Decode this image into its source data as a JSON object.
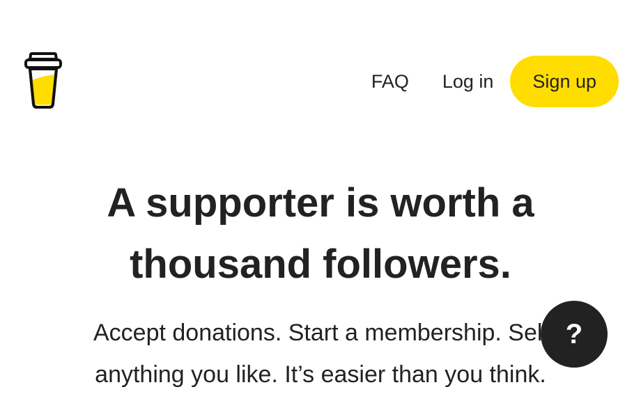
{
  "header": {
    "logo_name": "buy-me-a-coffee-cup-icon",
    "nav": {
      "faq_label": "FAQ",
      "login_label": "Log in",
      "signup_label": "Sign up"
    }
  },
  "hero": {
    "title_line1": "A supporter is worth a",
    "title_line2": "thousand followers.",
    "subtitle_line1": "Accept donations. Start a membership. Sell",
    "subtitle_line2": "anything you like. It’s easier than you think."
  },
  "help_widget": {
    "icon": "question-mark-icon",
    "label": "?"
  },
  "colors": {
    "accent": "#FFDD00",
    "text": "#222222",
    "background": "#FFFFFF"
  }
}
